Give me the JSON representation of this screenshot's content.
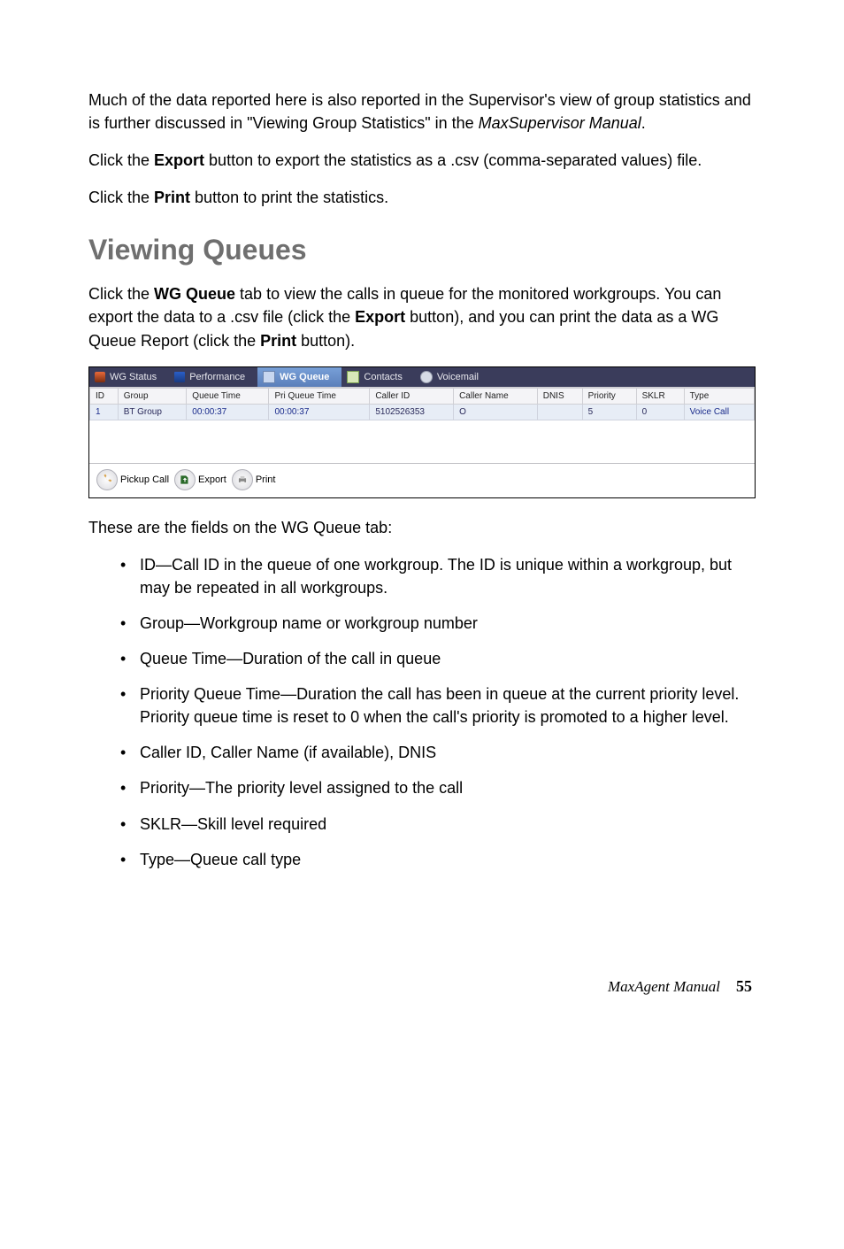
{
  "intro": {
    "p1_a": "Much of the data reported here is also reported in the Supervisor's view of group statistics and is further discussed in \"Viewing Group Statistics\" in the ",
    "p1_italic": "MaxSupervisor Manual",
    "p1_b": ".",
    "p2_a": "Click the ",
    "p2_bold": "Export",
    "p2_b": " button to export the statistics as a .csv (comma-separated values) file.",
    "p3_a": "Click the ",
    "p3_bold": "Print",
    "p3_b": " button to print the statistics."
  },
  "section_title": "Viewing Queues",
  "after_title": {
    "p_a": "Click the ",
    "p_bold1": "WG Queue",
    "p_b": " tab to view the calls in queue for the monitored workgroups. You can export the data to a .csv file (click the ",
    "p_bold2": "Export",
    "p_c": " button), and you can print the data as a WG Queue Report (click the ",
    "p_bold3": "Print",
    "p_d": " button)."
  },
  "tabs": {
    "status": "WG Status",
    "perf": "Performance",
    "queue": "WG Queue",
    "contacts": "Contacts",
    "vm": "Voicemail"
  },
  "table": {
    "headers": [
      "ID",
      "Group",
      "Queue Time",
      "Pri Queue Time",
      "Caller ID",
      "Caller Name",
      "DNIS",
      "Priority",
      "SKLR",
      "Type"
    ],
    "row": [
      "1",
      "BT Group",
      "00:00:37",
      "00:00:37",
      "5102526353",
      "O",
      "",
      "5",
      "0",
      "Voice Call"
    ]
  },
  "toolbar": {
    "pickup": "Pickup Call",
    "export": "Export",
    "print": "Print"
  },
  "fields_intro": "These are the fields on the WG Queue tab:",
  "fields": {
    "id_b": "ID",
    "id_t": "—Call ID in the queue of one workgroup. The ID is unique within a workgroup, but may be repeated in all workgroups.",
    "group_b": "Group",
    "group_t": "—Workgroup name or workgroup number",
    "qt_b": "Queue Time",
    "qt_t": "—Duration of the call in queue",
    "pqt_b": "Priority Queue Time",
    "pqt_t": "—Duration the call has been in queue at the current priority level. Priority queue time is reset to 0 when the call's priority is promoted to a higher level.",
    "cid_b1": "Caller ID",
    "cid_m": ", ",
    "cid_b2": "Caller Name",
    "cid_t": " (if available), ",
    "cid_b3": "DNIS",
    "pri_b": "Priority",
    "pri_t": "—The priority level assigned to the call",
    "sklr_b": "SKLR",
    "sklr_t": "—Skill level required",
    "type_b": "Type",
    "type_t": "—Queue call type"
  },
  "footer": {
    "book": "MaxAgent Manual",
    "page": "55"
  }
}
